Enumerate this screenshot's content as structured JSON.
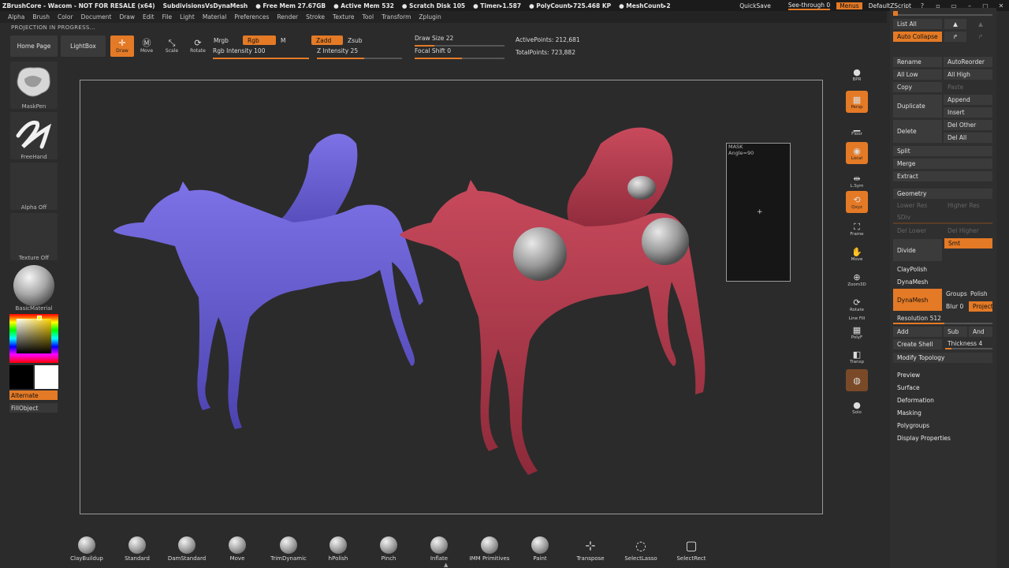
{
  "titlebar": {
    "app": "ZBrushCore - Wacom - NOT FOR RESALE (x64)",
    "project": "SubdivisionsVsDynaMesh",
    "free_mem": "● Free Mem 27.67GB",
    "active_mem": "● Active Mem 532",
    "scratch": "● Scratch Disk 105",
    "timer": "● Timer▸1.587",
    "polycount": "● PolyCount▸725.468 KP",
    "meshcount": "● MeshCount▸2",
    "quicksave": "QuickSave",
    "see_through": "See-through 0",
    "menus": "Menus",
    "script": "DefaultZScript",
    "win_buttons": [
      "?",
      "▫",
      "▭",
      "–",
      "▢",
      "✕"
    ]
  },
  "menubar": [
    "Alpha",
    "Brush",
    "Color",
    "Document",
    "Draw",
    "Edit",
    "File",
    "Light",
    "Material",
    "Preferences",
    "Render",
    "Stroke",
    "Texture",
    "Tool",
    "Transform",
    "Zplugin"
  ],
  "status": "PROJECTION IN PROGRESS...",
  "toolbar": {
    "home": "Home Page",
    "lightbox": "LightBox",
    "draw": "Draw",
    "move": "Move",
    "scale": "Scale",
    "rotate": "Rotate",
    "mrgb": "Mrgb",
    "rgb": "Rgb",
    "m": "M",
    "zadd": "Zadd",
    "zsub": "Zsub",
    "rgb_intensity": "Rgb Intensity 100",
    "z_intensity": "Z Intensity 25",
    "draw_size": "Draw Size 22",
    "focal_shift": "Focal Shift 0",
    "active_points": "ActivePoints: 212,681",
    "total_points": "TotalPoints: 723,882"
  },
  "left": {
    "brush": "MaskPen",
    "stroke": "FreeHand",
    "alpha": "Alpha Off",
    "texture": "Texture Off",
    "material": "BasicMaterial",
    "alternate": "Alternate",
    "fillobject": "FillObject"
  },
  "mask": {
    "title": "MASK",
    "angle": "Angle=90",
    "cursor": "+"
  },
  "right_icons": [
    {
      "name": "bpr-icon",
      "label": "BPR",
      "glyph": "●"
    },
    {
      "name": "persp-icon",
      "label": "Persp",
      "glyph": "▦"
    },
    {
      "name": "floor-icon",
      "label": "Floor",
      "glyph": "▁"
    },
    {
      "name": "local-icon",
      "label": "Local",
      "glyph": "◉"
    },
    {
      "name": "lsym-icon",
      "label": "L.Sym",
      "glyph": "⇹"
    },
    {
      "name": "xyz-icon",
      "label": "Qxyz",
      "glyph": "⟲"
    },
    {
      "name": "frame-icon",
      "label": "Frame",
      "glyph": "⛶"
    },
    {
      "name": "move-icon",
      "label": "Move",
      "glyph": "✋"
    },
    {
      "name": "zoom3d-icon",
      "label": "Zoom3D",
      "glyph": "⊕"
    },
    {
      "name": "rotate-icon",
      "label": "Rotate",
      "glyph": "⟳"
    },
    {
      "name": "polyf-icon",
      "label": "PolyF",
      "glyph": "▦"
    },
    {
      "name": "transp-icon",
      "label": "Transp",
      "glyph": "◧"
    },
    {
      "name": "ghost-icon",
      "label": "",
      "glyph": "◍"
    },
    {
      "name": "solo-icon",
      "label": "Solo",
      "glyph": "●"
    }
  ],
  "right_strip_label": "Line Fill",
  "panel": {
    "list_all": "List All",
    "auto_collapse": "Auto Collapse",
    "rename": "Rename",
    "autoreorder": "AutoReorder",
    "all_low": "All Low",
    "all_high": "All High",
    "copy": "Copy",
    "paste": "Paste",
    "duplicate": "Duplicate",
    "append": "Append",
    "insert": "Insert",
    "delete": "Delete",
    "del_other": "Del Other",
    "del_all": "Del All",
    "split": "Split",
    "merge": "Merge",
    "extract": "Extract",
    "geometry": "Geometry",
    "lower_res": "Lower Res",
    "higher_res": "Higher Res",
    "sdiv": "SDiv",
    "del_lower": "Del Lower",
    "del_higher": "Del Higher",
    "divide": "Divide",
    "smt": "Smt",
    "claypolish": "ClayPolish",
    "dynamesh_head": "DynaMesh",
    "dynamesh": "DynaMesh",
    "groups": "Groups",
    "polish": "Polish",
    "blur": "Blur 0",
    "project": "Project",
    "resolution": "Resolution 512",
    "add": "Add",
    "sub": "Sub",
    "and": "And",
    "create_shell": "Create Shell",
    "thickness": "Thickness 4",
    "modify_topology": "Modify Topology",
    "preview": "Preview",
    "surface": "Surface",
    "deformation": "Deformation",
    "masking": "Masking",
    "polygroups": "Polygroups",
    "display_properties": "Display Properties"
  },
  "brushes": [
    {
      "name": "ClayBuildup",
      "icon": "ball"
    },
    {
      "name": "Standard",
      "icon": "ball"
    },
    {
      "name": "DamStandard",
      "icon": "ball"
    },
    {
      "name": "Move",
      "icon": "ball"
    },
    {
      "name": "TrimDynamic",
      "icon": "ball"
    },
    {
      "name": "hPolish",
      "icon": "ball"
    },
    {
      "name": "Pinch",
      "icon": "ball"
    },
    {
      "name": "Inflate",
      "icon": "ball"
    },
    {
      "name": "IMM Primitives",
      "icon": "ball"
    },
    {
      "name": "Paint",
      "icon": "ball"
    },
    {
      "name": "Transpose",
      "icon": "⊹"
    },
    {
      "name": "SelectLasso",
      "icon": "◌"
    },
    {
      "name": "SelectRect",
      "icon": "▢"
    }
  ],
  "colors": {
    "accent": "#e47a26",
    "blue_dog": "#6a5fd0",
    "red_dog": "#b23a4c"
  }
}
